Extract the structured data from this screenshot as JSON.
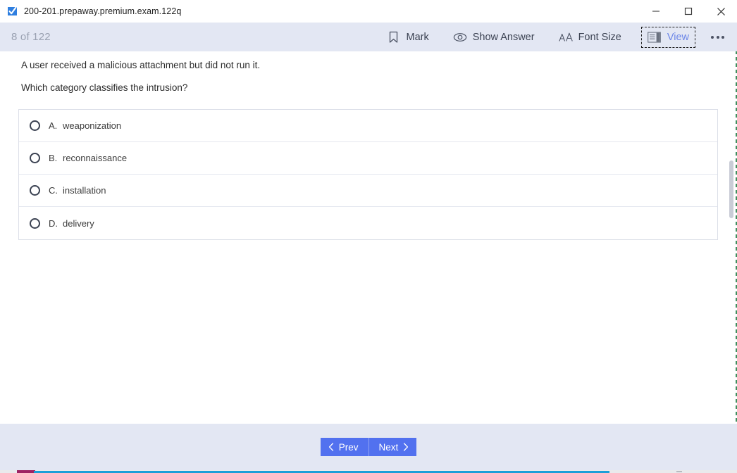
{
  "window": {
    "title": "200-201.prepaway.premium.exam.122q",
    "app_icon": "blue-check-icon",
    "controls": {
      "minimize": "minimize-icon",
      "maximize": "maximize-icon",
      "close": "close-icon"
    }
  },
  "toolbar": {
    "counter": "8 of 122",
    "buttons": [
      {
        "label": "Mark",
        "icon": "bookmark-icon"
      },
      {
        "label": "Show Answer",
        "icon": "eye-icon"
      },
      {
        "label": "Font Size",
        "icon": "font-size-icon"
      },
      {
        "label": "View",
        "icon": "view-panel-icon",
        "focused": true
      }
    ],
    "overflow_label": "",
    "overflow_icon": "more-options-icon"
  },
  "question": {
    "stem_line_1": "A user received a malicious attachment but did not run it.",
    "stem_line_2": "Which category classifies the intrusion?",
    "options": [
      {
        "letter": "A.",
        "text": "weaponization",
        "selected": false
      },
      {
        "letter": "B.",
        "text": "reconnaissance",
        "selected": false
      },
      {
        "letter": "C.",
        "text": "installation",
        "selected": false
      },
      {
        "letter": "D.",
        "text": "delivery",
        "selected": false
      }
    ]
  },
  "footer": {
    "prev_label": "Prev",
    "next_label": "Next",
    "prev_icon": "chevron-left-icon",
    "next_icon": "chevron-right-icon"
  },
  "colors": {
    "toolbar_bg": "#e3e7f3",
    "accent_button": "#5271ef",
    "view_active_text": "#6d87e8",
    "counter_text": "#9aa1b1",
    "option_border": "#dcdfe8"
  }
}
